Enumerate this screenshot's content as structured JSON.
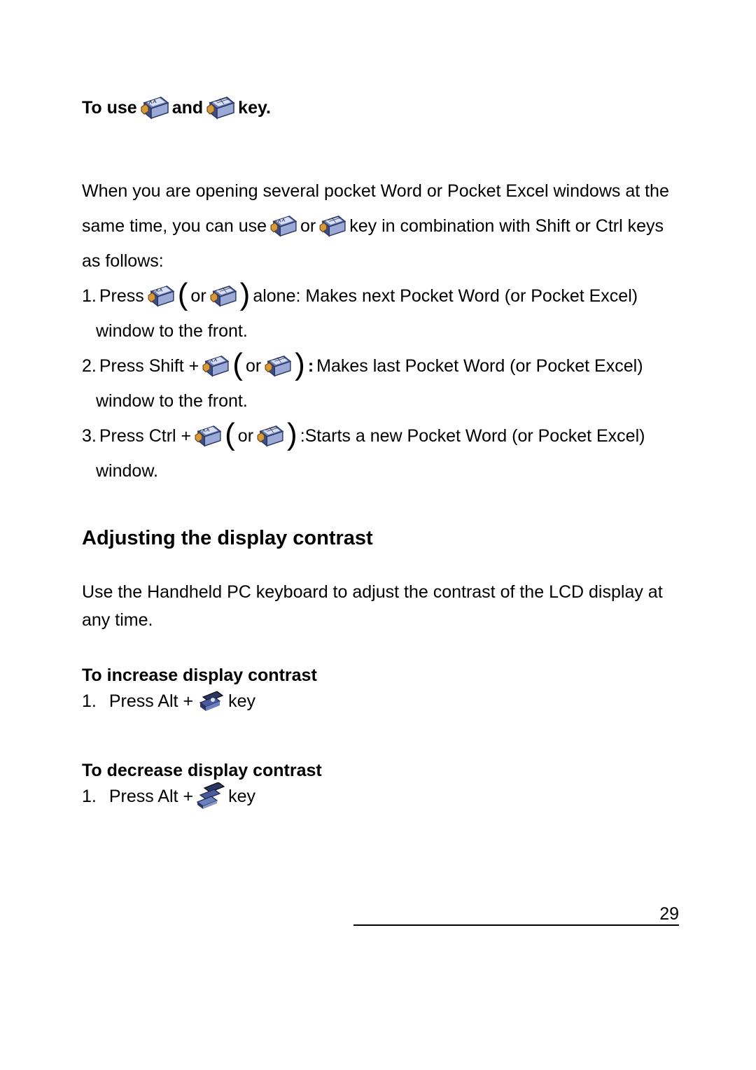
{
  "heading": {
    "pre": "To use ",
    "mid": " and",
    "post": "key."
  },
  "intro": {
    "line1": "When you are opening several pocket Word or Pocket Excel windows at the",
    "line2a": "same time, you can use ",
    "line2b": "or",
    "line2c": "key in combination with Shift or Ctrl keys",
    "line3": "as follows:"
  },
  "items": [
    {
      "num": "1.",
      "pre": "Press",
      "mid_or": "or",
      "post": "alone: Makes next Pocket Word (or Pocket Excel)",
      "cont": "window to the front."
    },
    {
      "num": "2.",
      "pre": "Press Shift + ",
      "mid_or": "or",
      "bold_colon": ":",
      "post": "Makes last Pocket Word (or Pocket Excel)",
      "cont": "window to the front."
    },
    {
      "num": "3.",
      "pre": "Press Ctrl +",
      "mid_or": "or",
      "post": ":Starts a new Pocket Word (or Pocket Excel)",
      "cont": "window."
    }
  ],
  "contrast": {
    "title": "Adjusting the display contrast",
    "desc": "Use the Handheld PC keyboard  to adjust the contrast of the LCD display at any time.",
    "increase_title": "To increase display contrast",
    "increase_num": "1.",
    "increase_pre": "Press  Alt + ",
    "increase_post": "  key",
    "decrease_title": "To decrease display contrast",
    "decrease_num": "1.",
    "decrease_pre": "Press  Alt + ",
    "decrease_post": "  key"
  },
  "page_number": "29"
}
